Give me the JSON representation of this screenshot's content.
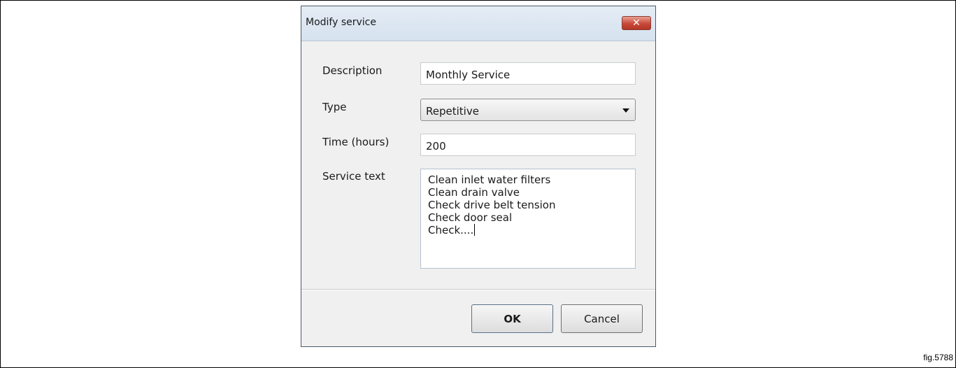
{
  "dialog": {
    "title": "Modify service",
    "close_symbol": "✕"
  },
  "form": {
    "description_label": "Description",
    "description_value": "Monthly Service",
    "type_label": "Type",
    "type_value": "Repetitive",
    "time_label": "Time (hours)",
    "time_value": "200",
    "service_text_label": "Service text",
    "service_text_lines": [
      "Clean inlet water filters",
      "Clean drain valve",
      "Check drive belt tension",
      "Check door seal",
      "Check...."
    ]
  },
  "buttons": {
    "ok_label": "OK",
    "cancel_label": "Cancel"
  },
  "figure": {
    "label": "fig.5788"
  },
  "icons": {
    "close": "close-icon",
    "dropdown": "chevron-down-icon"
  }
}
